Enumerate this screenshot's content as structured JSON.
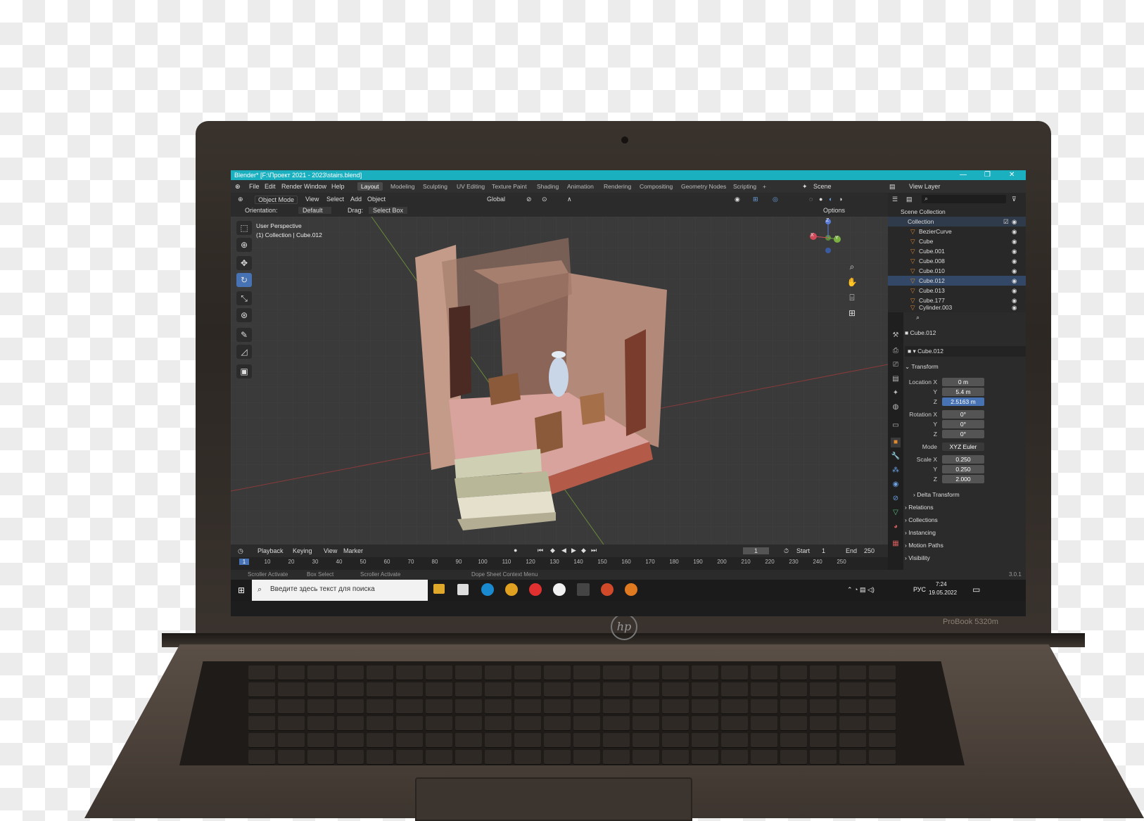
{
  "window": {
    "title": "Blender* [F:\\Проект 2021 - 2023\\stairs.blend]",
    "controls": [
      "—",
      "❐",
      "✕"
    ]
  },
  "menu": [
    "File",
    "Edit",
    "Render",
    "Window",
    "Help"
  ],
  "workspaces": [
    "Layout",
    "Modeling",
    "Sculpting",
    "UV Editing",
    "Texture Paint",
    "Shading",
    "Animation",
    "Rendering",
    "Compositing",
    "Geometry Nodes",
    "Scripting",
    "+"
  ],
  "active_workspace": "Layout",
  "scene": "Scene",
  "view_layer": "View Layer",
  "header": {
    "mode": "Object Mode",
    "menus": [
      "View",
      "Select",
      "Add",
      "Object"
    ],
    "orientation_global": "Global",
    "orientation_label": "Orientation:",
    "orientation_value": "Default",
    "drag_label": "Drag:",
    "drag_value": "Select Box",
    "options": "Options"
  },
  "viewport": {
    "perspective": "User Perspective",
    "context": "(1) Collection | Cube.012"
  },
  "gizmo": {
    "x": "X",
    "y": "Y",
    "z": "Z"
  },
  "timeline": {
    "menus": [
      "Playback",
      "Keying",
      "View",
      "Marker"
    ],
    "current_frame": "1",
    "start_label": "Start",
    "start": "1",
    "end_label": "End",
    "end": "250",
    "ticks": [
      "1",
      "10",
      "20",
      "30",
      "40",
      "50",
      "60",
      "70",
      "80",
      "90",
      "100",
      "110",
      "120",
      "130",
      "140",
      "150",
      "160",
      "170",
      "180",
      "190",
      "200",
      "210",
      "220",
      "230",
      "240",
      "250"
    ]
  },
  "statusbar": {
    "items": [
      "Scroller Activate",
      "Box Select",
      "Scroller Activate",
      "Dope Sheet Context Menu"
    ],
    "version": "3.0.1"
  },
  "outliner": {
    "root": "Scene Collection",
    "collection": "Collection",
    "items": [
      "BezierCurve",
      "Cube",
      "Cube.001",
      "Cube.008",
      "Cube.010",
      "Cube.012",
      "Cube.013",
      "Cube.177",
      "Cylinder.003"
    ]
  },
  "properties": {
    "object_name": "Cube.012",
    "data_name": "Cube.012",
    "transform_label": "Transform",
    "location_label": "Location X",
    "location": [
      "0 m",
      "5.4 m",
      "2.5163 m"
    ],
    "rotation_label": "Rotation X",
    "rotation": [
      "0°",
      "0°",
      "0°"
    ],
    "mode_label": "Mode",
    "mode": "XYZ Euler",
    "scale_label": "Scale X",
    "scale": [
      "0.250",
      "0.250",
      "2.000"
    ],
    "axis_y": "Y",
    "axis_z": "Z",
    "sections": [
      "Delta Transform",
      "Relations",
      "Collections",
      "Instancing",
      "Motion Paths",
      "Visibility"
    ]
  },
  "taskbar": {
    "search_placeholder": "Введите здесь текст для поиска",
    "lang": "РУС",
    "time": "7:24",
    "date": "19.05.2022"
  },
  "laptop": {
    "brand": "hp",
    "model": "ProBook 5320m"
  }
}
